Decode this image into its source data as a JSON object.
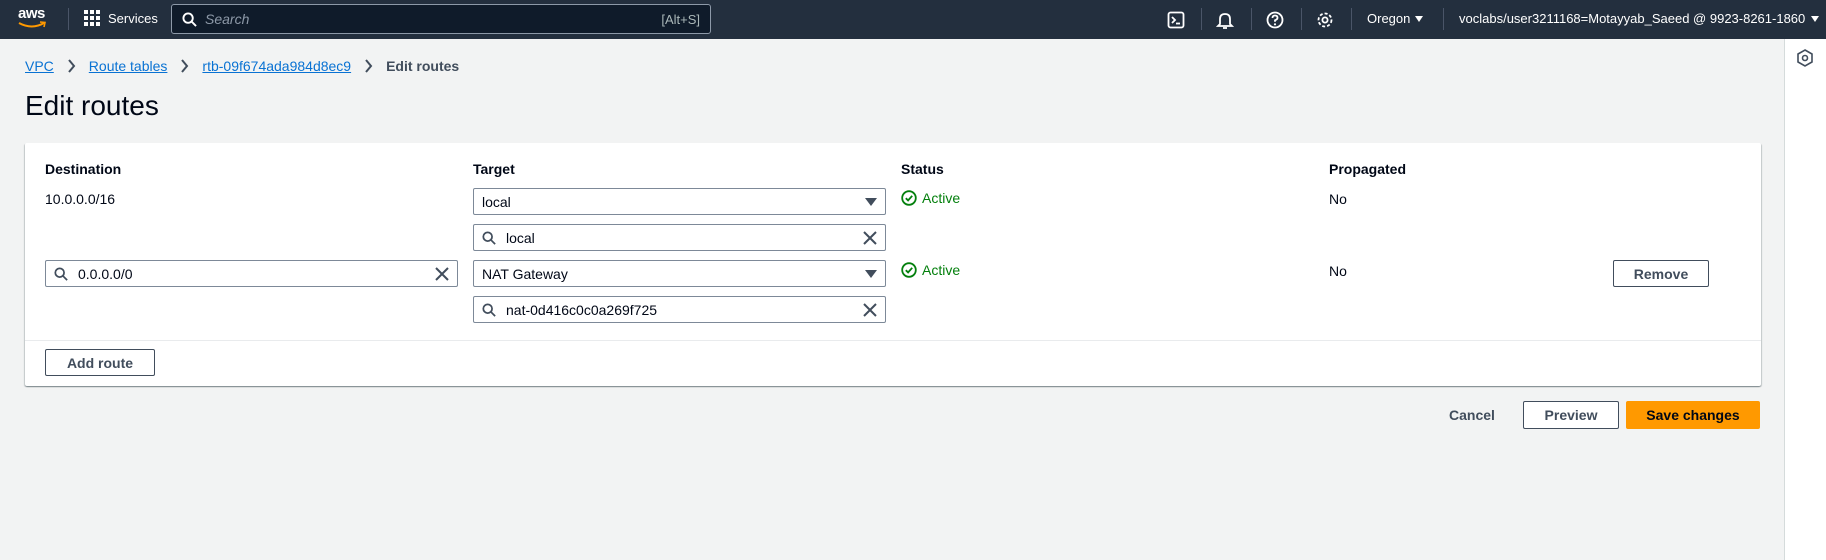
{
  "nav": {
    "logo_text": "aws",
    "services_label": "Services",
    "search_placeholder": "Search",
    "search_shortcut": "[Alt+S]",
    "region": "Oregon",
    "account": "voclabs/user3211168=Motayyab_Saeed @ 9923-8261-1860"
  },
  "breadcrumbs": [
    {
      "label": "VPC"
    },
    {
      "label": "Route tables"
    },
    {
      "label": "rtb-09f674ada984d8ec9"
    },
    {
      "label": "Edit routes"
    }
  ],
  "page_title": "Edit routes",
  "table": {
    "headers": {
      "destination": "Destination",
      "target": "Target",
      "status": "Status",
      "propagated": "Propagated"
    },
    "routes": [
      {
        "destination": "10.0.0.0/16",
        "target_type": "local",
        "target_value": "local",
        "status": "Active",
        "propagated": "No"
      },
      {
        "destination": "0.0.0.0/0",
        "target_type": "NAT Gateway",
        "target_value": "nat-0d416c0c0a269f725",
        "status": "Active",
        "propagated": "No",
        "remove_label": "Remove"
      }
    ],
    "add_route_label": "Add route"
  },
  "actions": {
    "cancel": "Cancel",
    "preview": "Preview",
    "save": "Save changes"
  },
  "colors": {
    "nav_bg": "#232f3e",
    "link": "#0972d3",
    "status_success": "#037f0c",
    "primary": "#ff9900"
  }
}
